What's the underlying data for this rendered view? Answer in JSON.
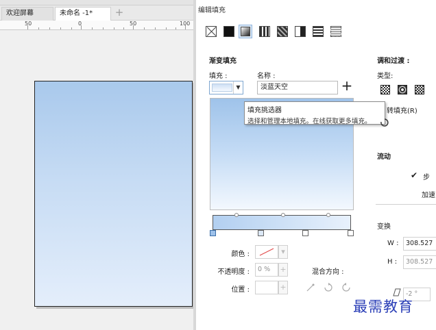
{
  "tabs": [
    {
      "label": "欢迎屏幕"
    },
    {
      "label": "未命名 -1*"
    }
  ],
  "ruler_labels": [
    "50",
    "0",
    "50",
    "100"
  ],
  "dialog": {
    "title": "编辑填充",
    "fill_types": [
      "none-fill-icon",
      "uniform-fill-icon",
      "fountain-fill-icon",
      "vector-pattern-icon",
      "bitmap-pattern-icon",
      "two-color-pattern-icon",
      "texture-fill-icon",
      "postscript-fill-icon"
    ],
    "section_title": "渐变填充",
    "fill_label": "填充 :",
    "name_label": "名称 :",
    "name_value": "淡蓝天空",
    "add_glyph": "+",
    "tooltip": {
      "title": "填充挑选器",
      "description": "选择和管理本地填充。在线获取更多填充。"
    },
    "color_label": "颜色 :",
    "opacity_label": "不透明度 :",
    "opacity_value": "0 %",
    "position_label": "位置 :",
    "blend_direction_label": "混合方向 :",
    "blend_section_title": "调和过渡 :",
    "type_label": "类型:",
    "reverse_fill_label": "转填充(R)",
    "flow_title": "流动",
    "step_label": "步",
    "accel_label": "加速",
    "transform_title": "变换",
    "w_label": "W :",
    "w_value": "308.527",
    "h_label": "H :",
    "h_value": "308.527",
    "rotation_value": "-2 °"
  },
  "watermark": "最需教育",
  "colors": {
    "accent": "#2b3fb7",
    "gradient_start": "#a9c9ec",
    "gradient_end": "#e4eefb"
  }
}
